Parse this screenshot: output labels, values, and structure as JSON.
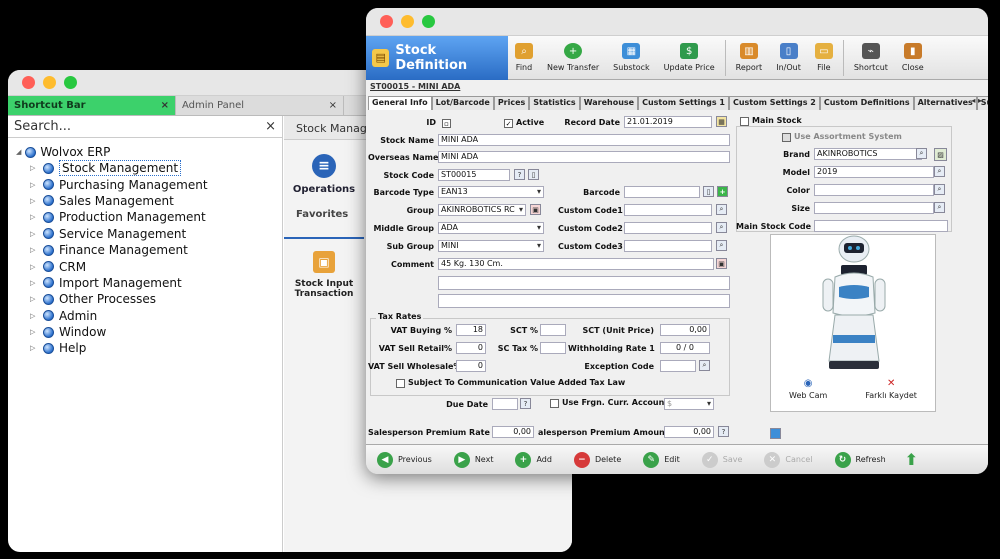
{
  "back_window": {
    "tabs": [
      {
        "label": "Shortcut Bar",
        "close": "×"
      },
      {
        "label": "Admin Panel",
        "close": "×"
      }
    ],
    "search_placeholder": "Search...",
    "search_close": "×",
    "tree_root": "Wolvox ERP",
    "tree_items": [
      "Stock Management",
      "Purchasing Management",
      "Sales Management",
      "Production Management",
      "Service Management",
      "Finance Management",
      "CRM",
      "Import Management",
      "Other Processes",
      "Admin",
      "Window",
      "Help"
    ],
    "right_tab": "Stock Manag",
    "operations_label": "Operations",
    "favorites_label": "Favorites",
    "stock_input_label": "Stock Input Transaction"
  },
  "front_window": {
    "title": "Stock Definition",
    "toolbar": [
      "Find",
      "New Transfer",
      "Substock",
      "Update Price",
      "Report",
      "In/Out",
      "File",
      "Shortcut",
      "Close"
    ],
    "breadcrumb": "ST00015 - MINI ADA",
    "tabs": [
      "General Info",
      "Lot/Barcode",
      "Prices",
      "Statistics",
      "Warehouse",
      "Custom Settings 1",
      "Custom Settings 2",
      "Custom Definitions",
      "Alternatives",
      "Sub Products"
    ],
    "tab_arrows": "◂ ▸",
    "labels": {
      "id": "ID",
      "active": "Active",
      "record_date": "Record Date",
      "stock_name": "Stock Name",
      "overseas_name": "Overseas Name",
      "stock_code": "Stock Code",
      "barcode_type": "Barcode Type",
      "barcode": "Barcode",
      "group": "Group",
      "custom_code1": "Custom Code1",
      "middle_group": "Middle Group",
      "custom_code2": "Custom Code2",
      "sub_group": "Sub Group",
      "custom_code3": "Custom Code3",
      "comment": "Comment",
      "tax_rates": "Tax Rates",
      "vat_buying": "VAT Buying %",
      "sct": "SCT %",
      "sct_unit_price": "SCT (Unit Price)",
      "vat_sell_retail": "VAT Sell Retail%",
      "sc_tax": "SC Tax %",
      "withholding_rate": "Withholding Rate 1",
      "vat_sell_wholesale": "VAT Sell Wholesale%",
      "exception_code": "Exception Code",
      "subject_comm": "Subject To Communication Value Added Tax Law",
      "due_date": "Due Date",
      "use_frgn": "Use Frgn. Curr. Account",
      "salesperson_rate": "Salesperson Premium Rate",
      "salesperson_amount": "alesperson Premium Amount",
      "main_stock": "Main Stock",
      "use_assortment": "Use Assortment System",
      "brand": "Brand",
      "model": "Model",
      "color": "Color",
      "size": "Size",
      "main_stock_code": "Main Stock Code"
    },
    "values": {
      "record_date": "21.01.2019",
      "stock_name": "MINI ADA",
      "overseas_name": "MINI ADA",
      "stock_code": "ST00015",
      "barcode_type": "EAN13",
      "group": "AKINROBOTICS RC",
      "middle_group": "ADA",
      "sub_group": "MINI",
      "comment": "45 Kg. 130 Cm.",
      "vat_buying": "18",
      "vat_sell_retail": "0",
      "vat_sell_wholesale": "0",
      "sct_unit_price": "0,00",
      "withholding_a": "0",
      "withholding_sep": "/",
      "withholding_b": "0",
      "due_date_code": "?",
      "frgn_value": "$",
      "salesperson_rate": "0,00",
      "salesperson_amount": "0,00",
      "brand": "AKINROBOTICS",
      "model": "2019"
    },
    "camera": [
      "Web Cam",
      "Farklı Kaydet"
    ],
    "bottom": [
      "Previous",
      "Next",
      "Add",
      "Delete",
      "Edit",
      "Save",
      "Cancel",
      "Refresh"
    ],
    "colors": {
      "title_blue": "#2a6cc4",
      "shortcut_green": "#3cd16b"
    }
  }
}
